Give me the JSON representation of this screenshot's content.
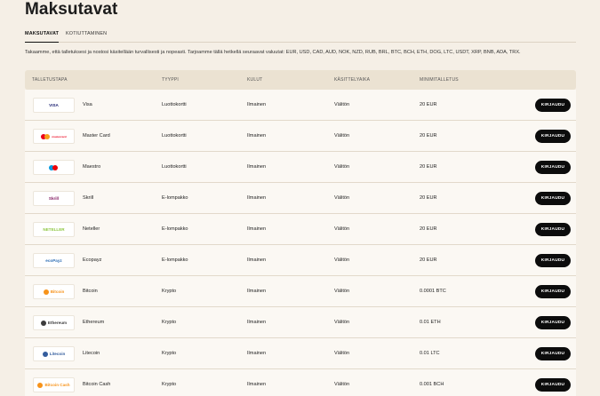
{
  "page": {
    "title": "Maksutavat",
    "tabs": [
      {
        "label": "MAKSUTAVAT",
        "active": true
      },
      {
        "label": "KOTIUTTAMINEN",
        "active": false
      }
    ],
    "intro": "Takaamme, että talletuksesi ja nostosi käsitellään turvallisesti ja nopeasti. Tarjoamme tällä hetkellä seuraavat valuutat: EUR, USD, CAD, AUD, NOK, NZD, RUB, BRL, BTC, BCH, ETH, DOG, LTC, USDT, XRP, BNB, ADA, TRX."
  },
  "table": {
    "headers": [
      "TALLETUSTAPA",
      "TYYPPI",
      "KULUT",
      "KÄSITTELYAIKA",
      "MINIMITALLETUS"
    ],
    "button_label": "KIRJAUDU",
    "rows": [
      {
        "method": "Visa",
        "type": "Luottokortti",
        "fee": "Ilmainen",
        "time": "Välitön",
        "min": "20 EUR",
        "logo": "VISA",
        "logo_color": "#1a1f71",
        "icon": "visa-logo-icon"
      },
      {
        "method": "Master Card",
        "type": "Luottokortti",
        "fee": "Ilmainen",
        "time": "Välitön",
        "min": "20 EUR",
        "logo": "mastercard",
        "logo_color": "#eb001b",
        "icon": "mastercard-logo-icon"
      },
      {
        "method": "Maestro",
        "type": "Luottokortti",
        "fee": "Ilmainen",
        "time": "Välitön",
        "min": "20 EUR",
        "logo": "",
        "logo_color": "#0099df",
        "icon": "maestro-logo-icon"
      },
      {
        "method": "Skrill",
        "type": "E-lompakko",
        "fee": "Ilmainen",
        "time": "Välitön",
        "min": "20 EUR",
        "logo": "Skrill",
        "logo_color": "#862165",
        "icon": "skrill-logo-icon"
      },
      {
        "method": "Neteller",
        "type": "E-lompakko",
        "fee": "Ilmainen",
        "time": "Välitön",
        "min": "20 EUR",
        "logo": "NETELLER",
        "logo_color": "#8dc63f",
        "icon": "neteller-logo-icon"
      },
      {
        "method": "Ecopayz",
        "type": "E-lompakko",
        "fee": "Ilmainen",
        "time": "Välitön",
        "min": "20 EUR",
        "logo": "ecoPayz",
        "logo_color": "#2f6fb5",
        "icon": "ecopayz-logo-icon"
      },
      {
        "method": "Bitcoin",
        "type": "Krypto",
        "fee": "Ilmainen",
        "time": "Välitön",
        "min": "0.0001 BTC",
        "logo": "Bitcoin",
        "logo_color": "#f7931a",
        "icon": "bitcoin-logo-icon"
      },
      {
        "method": "Ethereum",
        "type": "Krypto",
        "fee": "Ilmainen",
        "time": "Välitön",
        "min": "0.01 ETH",
        "logo": "Ethereum",
        "logo_color": "#3c3c3d",
        "icon": "ethereum-logo-icon"
      },
      {
        "method": "Litecoin",
        "type": "Krypto",
        "fee": "Ilmainen",
        "time": "Välitön",
        "min": "0.01 LTC",
        "logo": "Litecoin",
        "logo_color": "#345d9d",
        "icon": "litecoin-logo-icon"
      },
      {
        "method": "Bitcoin Cash",
        "type": "Krypto",
        "fee": "Ilmainen",
        "time": "Välitön",
        "min": "0.001 BCH",
        "logo": "Bitcoin Cash",
        "logo_color": "#f7931a",
        "icon": "bitcoin-cash-logo-icon"
      }
    ]
  }
}
